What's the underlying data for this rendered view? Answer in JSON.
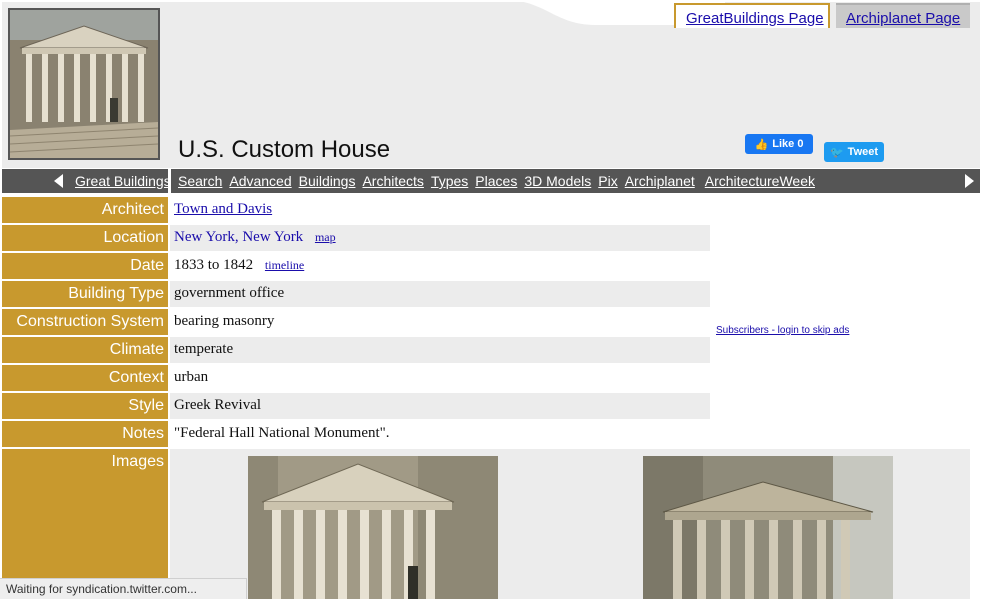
{
  "tabs": {
    "greatbuildings": "GreatBuildings Page",
    "archiplanet": "Archiplanet Page"
  },
  "title": "U.S. Custom House",
  "social": {
    "like_label": "Like 0",
    "tweet_label": "Tweet"
  },
  "nav": {
    "home": "Great Buildings",
    "links": [
      "Search",
      "Advanced",
      "Buildings",
      "Architects",
      "Types",
      "Places",
      "3D Models",
      "Pix",
      "Archiplanet",
      "ArchitectureWeek"
    ]
  },
  "details": [
    {
      "label": "Architect",
      "value": "Town and Davis"
    },
    {
      "label": "Location",
      "value": "New York, New York",
      "extra": "map"
    },
    {
      "label": "Date",
      "value": "1833 to 1842",
      "extra": "timeline"
    },
    {
      "label": "Building Type",
      "value": "government office"
    },
    {
      "label": "Construction System",
      "value": "bearing masonry"
    },
    {
      "label": "Climate",
      "value": "temperate"
    },
    {
      "label": "Context",
      "value": "urban"
    },
    {
      "label": "Style",
      "value": "Greek Revival"
    },
    {
      "label": "Notes",
      "value": "\"Federal Hall National Monument\"."
    }
  ],
  "images_label": "Images",
  "subscribers_link": "Subscribers - login to skip ads",
  "status_text": "Waiting for syndication.twitter.com...",
  "colors": {
    "accent": "#c8992e",
    "nav_bg": "#555555",
    "panel_bg": "#ececec",
    "link": "#1a0dab"
  }
}
